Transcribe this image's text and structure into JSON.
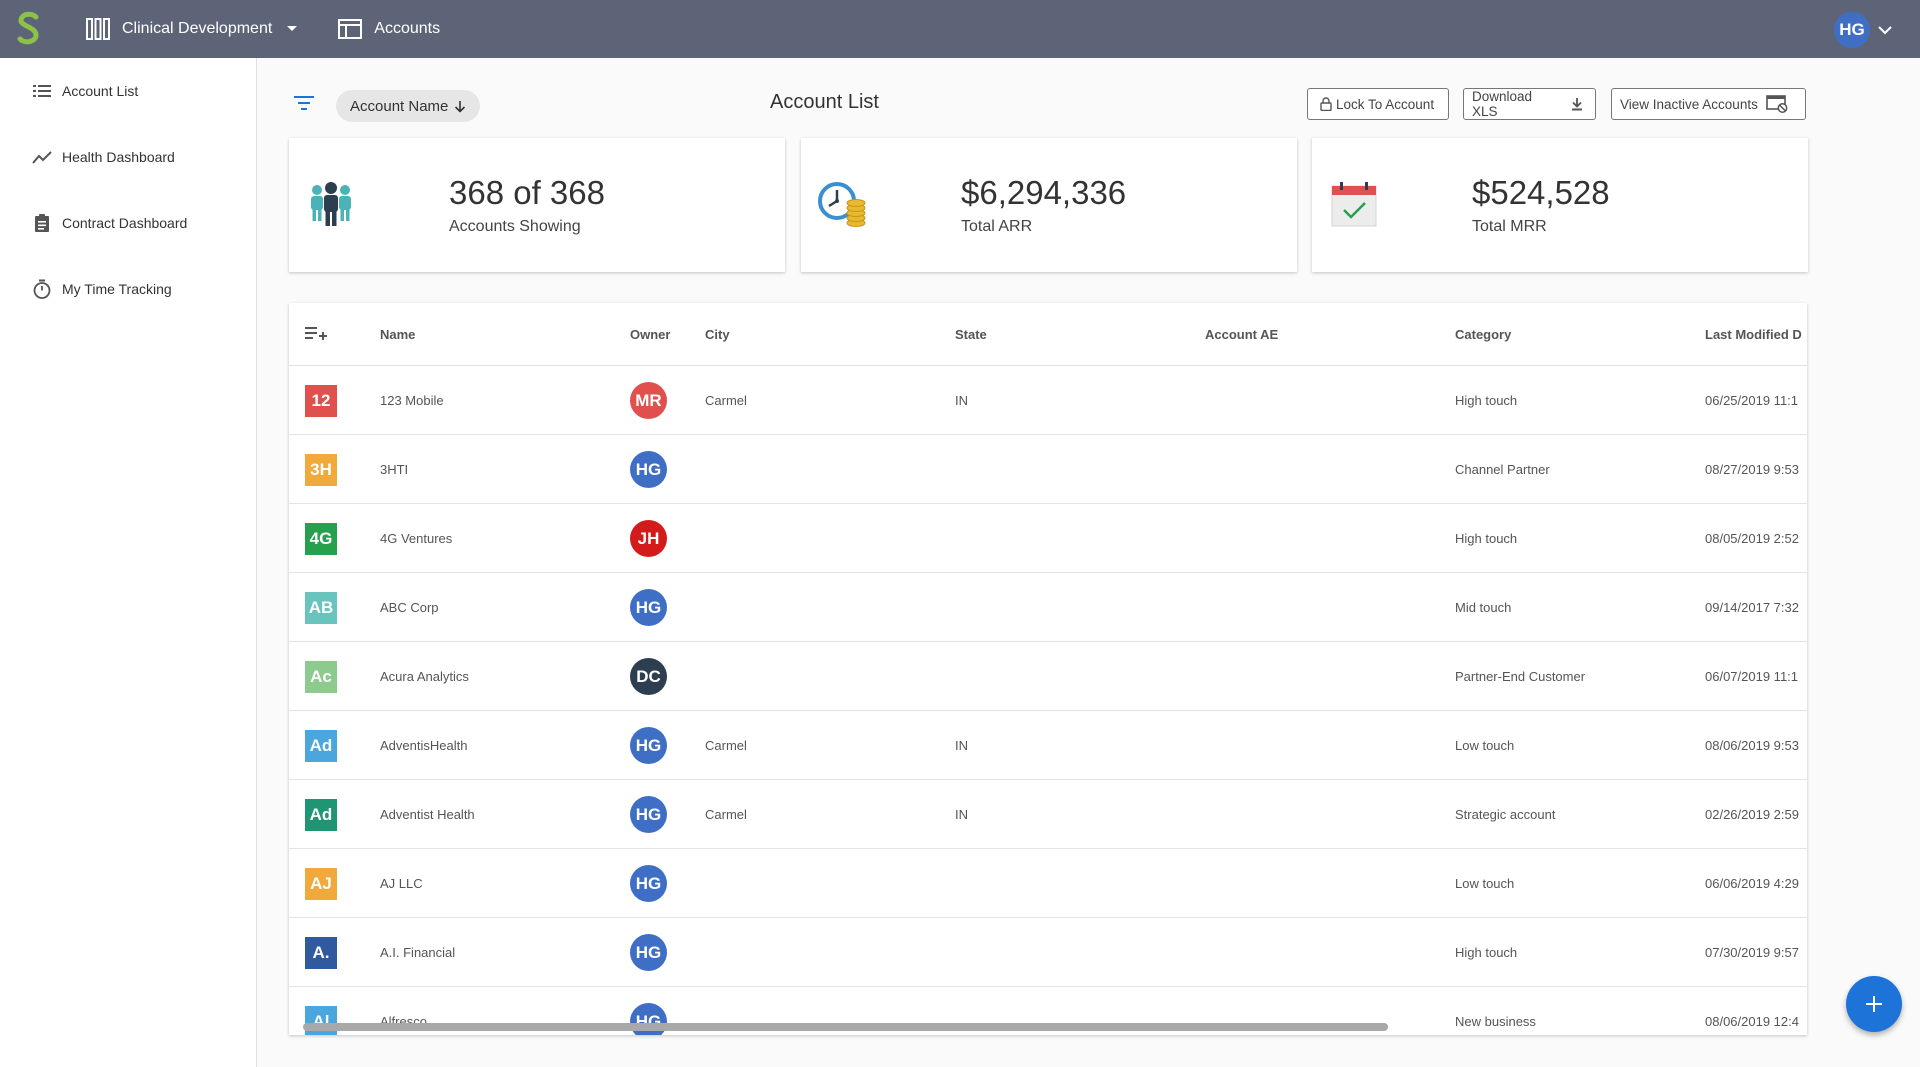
{
  "topbar": {
    "workspace_label": "Clinical Development",
    "accounts_label": "Accounts",
    "user_initials": "HG"
  },
  "sidebar": {
    "items": [
      {
        "label": "Account List",
        "icon": "list-icon"
      },
      {
        "label": "Health Dashboard",
        "icon": "trending-icon"
      },
      {
        "label": "Contract Dashboard",
        "icon": "clipboard-icon"
      },
      {
        "label": "My Time Tracking",
        "icon": "stopwatch-icon"
      }
    ]
  },
  "toolbar": {
    "sort_label": "Account Name",
    "title": "Account List",
    "lock_label": "Lock To Account",
    "download_label": "Download XLS",
    "inactive_label": "View Inactive Accounts"
  },
  "stats": {
    "accounts": {
      "value": "368 of 368",
      "caption": "Accounts Showing"
    },
    "arr": {
      "value": "$6,294,336",
      "caption": "Total ARR"
    },
    "mrr": {
      "value": "$524,528",
      "caption": "Total MRR"
    }
  },
  "table": {
    "columns": [
      "Name",
      "Owner",
      "City",
      "State",
      "Account AE",
      "Category",
      "Last Modified D"
    ],
    "rows": [
      {
        "badge": "12",
        "badge_color": "#e0514d",
        "name": "123 Mobile",
        "owner": "MR",
        "owner_color": "#e0514d",
        "city": "Carmel",
        "state": "IN",
        "ae": "",
        "category": "High touch",
        "modified": "06/25/2019 11:1"
      },
      {
        "badge": "3H",
        "badge_color": "#f2a93b",
        "name": "3HTI",
        "owner": "HG",
        "owner_color": "#3f6fc5",
        "city": "",
        "state": "",
        "ae": "",
        "category": "Channel Partner",
        "modified": "08/27/2019 9:53"
      },
      {
        "badge": "4G",
        "badge_color": "#27a04d",
        "name": "4G Ventures",
        "owner": "JH",
        "owner_color": "#d41b1b",
        "city": "",
        "state": "",
        "ae": "",
        "category": "High touch",
        "modified": "08/05/2019 2:52"
      },
      {
        "badge": "AB",
        "badge_color": "#68c4bd",
        "name": "ABC Corp",
        "owner": "HG",
        "owner_color": "#3f6fc5",
        "city": "",
        "state": "",
        "ae": "",
        "category": "Mid touch",
        "modified": "09/14/2017 7:32"
      },
      {
        "badge": "Ac",
        "badge_color": "#8ec98d",
        "name": "Acura Analytics",
        "owner": "DC",
        "owner_color": "#2c3e50",
        "city": "",
        "state": "",
        "ae": "",
        "category": "Partner-End Customer",
        "modified": "06/07/2019 11:1"
      },
      {
        "badge": "Ad",
        "badge_color": "#4aa6dc",
        "name": "AdventisHealth",
        "owner": "HG",
        "owner_color": "#3f6fc5",
        "city": "Carmel",
        "state": "IN",
        "ae": "",
        "category": "Low touch",
        "modified": "08/06/2019 9:53"
      },
      {
        "badge": "Ad",
        "badge_color": "#1e9673",
        "name": "Adventist Health",
        "owner": "HG",
        "owner_color": "#3f6fc5",
        "city": "Carmel",
        "state": "IN",
        "ae": "",
        "category": "Strategic account",
        "modified": "02/26/2019 2:59"
      },
      {
        "badge": "AJ",
        "badge_color": "#f2a93b",
        "name": "AJ LLC",
        "owner": "HG",
        "owner_color": "#3f6fc5",
        "city": "",
        "state": "",
        "ae": "",
        "category": "Low touch",
        "modified": "06/06/2019 4:29"
      },
      {
        "badge": "A.",
        "badge_color": "#2f5b9e",
        "name": "A.I. Financial",
        "owner": "HG",
        "owner_color": "#3f6fc5",
        "city": "",
        "state": "",
        "ae": "",
        "category": "High touch",
        "modified": "07/30/2019 9:57"
      },
      {
        "badge": "Al",
        "badge_color": "#4aa6dc",
        "name": "Alfresco",
        "owner": "HG",
        "owner_color": "#3f6fc5",
        "city": "",
        "state": "",
        "ae": "",
        "category": "New business",
        "modified": "08/06/2019 12:4"
      }
    ]
  },
  "colors": {
    "topbar": "#5e6478",
    "logo_green": "#8bc34a",
    "fab": "#1e73d8"
  }
}
